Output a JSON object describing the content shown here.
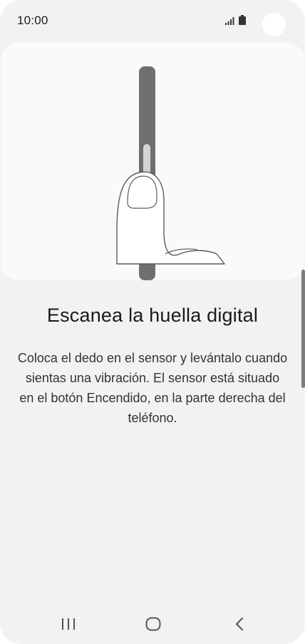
{
  "status_bar": {
    "time": "10:00",
    "icons": [
      "signal-icon",
      "battery-icon"
    ]
  },
  "illustration": {
    "subject": "finger-on-side-power-button-icon"
  },
  "content": {
    "title": "Escanea la huella digital",
    "description": "Coloca el dedo en el sensor y levántalo cuando sientas una vibración. El sensor está situado en el botón Encendido, en la parte derecha del teléfono."
  },
  "navigation_bar": {
    "buttons": [
      "recent-apps-icon",
      "home-icon",
      "back-icon"
    ]
  },
  "colors": {
    "background": "#f2f2f2",
    "card": "#fafafa",
    "text_primary": "#1a1a1a",
    "text_secondary": "#333333",
    "phone_edge": "#6f6f6f",
    "scroll_indicator": "#7a7a86"
  }
}
